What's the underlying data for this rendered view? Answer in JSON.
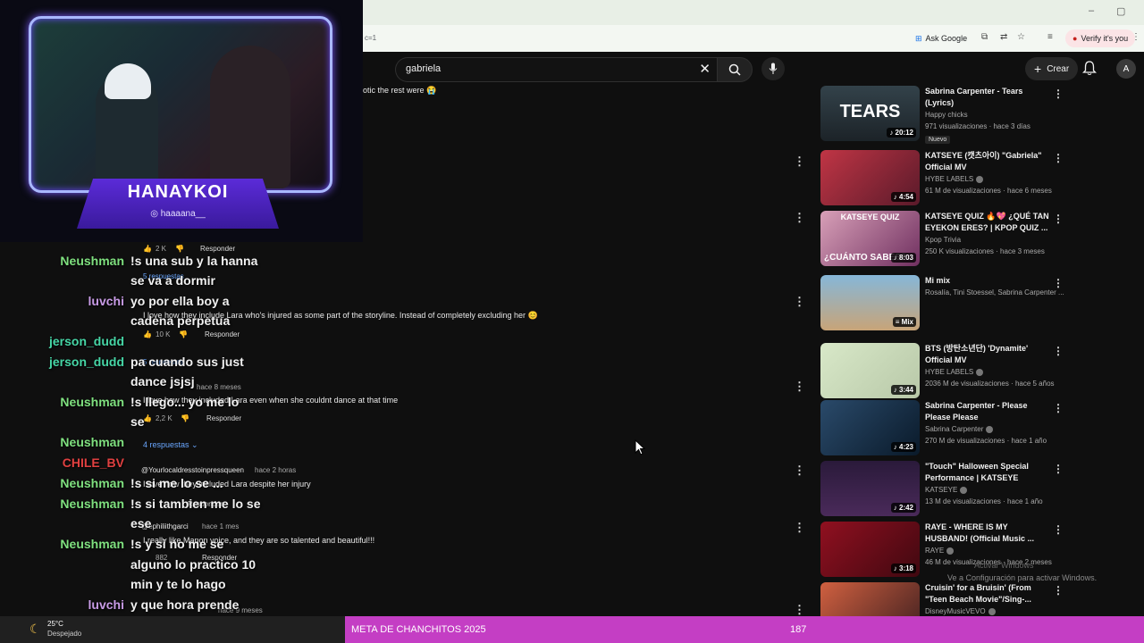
{
  "browser": {
    "url_fragment": "c=1",
    "ask_google_label": "Ask Google",
    "verify_label": "Verify it's you"
  },
  "youtube": {
    "search_value": "gabriela",
    "create_label": "Crear",
    "avatar_letter": "A"
  },
  "comments": {
    "frag_top": "otic the rest were 😭",
    "likes_1": "2 K",
    "reply_1": "Responder",
    "replies_toggle_1": "5 respuestas",
    "comment_2_text": "I love how they include Lara who's injured as some part of the storyline. Instead of completely excluding her 😊",
    "likes_2": "10 K",
    "reply_2": "Responder",
    "replies_toggle_2": "5 respuestas",
    "comment_3_time": "hace 8 meses",
    "comment_3_text": "I love how they included Lara even when she couldnt dance at that time",
    "likes_3": "2,2 K",
    "reply_3": "Responder",
    "replies_toggle_3": "4 respuestas",
    "comment_4_user": "@Yourlocaldresstoinpressqueen",
    "comment_4_time": "hace 2 horas",
    "comment_4_text": "I love how they included Lara despite her injury",
    "reply_4": "Responder",
    "comment_5_user": "@ephiliithgarci",
    "comment_5_time": "hace 1 mes",
    "comment_5_text": "I really like Manon voice, and they are so talented and beautiful!!!",
    "likes_5": "882",
    "reply_5": "Responder",
    "comment_6_time": "hace 9 meses"
  },
  "chat": [
    {
      "user": "Neushman",
      "color": "#7fe07f",
      "text": "!s una sub y la hanna"
    },
    {
      "user": "",
      "color": "",
      "text": "se va a dormir"
    },
    {
      "user": "luvchi",
      "color": "#c89be6",
      "text": "yo por ella boy a"
    },
    {
      "user": "",
      "color": "",
      "text": "cadena perpetua"
    },
    {
      "user": "jerson_dudd",
      "color": "#46d6a6",
      "text": ""
    },
    {
      "user": "jerson_dudd",
      "color": "#46d6a6",
      "text": "pa cuando sus just"
    },
    {
      "user": "",
      "color": "",
      "text": "dance jsjsj"
    },
    {
      "user": "Neushman",
      "color": "#7fe07f",
      "text": "!s llego... yo me lo"
    },
    {
      "user": "",
      "color": "",
      "text": "se"
    },
    {
      "user": "Neushman",
      "color": "#7fe07f",
      "text": ""
    },
    {
      "user": "CHILE_BV",
      "color": "#e04040",
      "text": ""
    },
    {
      "user": "Neushman",
      "color": "#7fe07f",
      "text": "!s si me lo se ..."
    },
    {
      "user": "Neushman",
      "color": "#7fe07f",
      "text": "!s si tambien me lo se"
    },
    {
      "user": "",
      "color": "",
      "text": "ese"
    },
    {
      "user": "Neushman",
      "color": "#7fe07f",
      "text": "!s y si no me se"
    },
    {
      "user": "",
      "color": "",
      "text": "alguno lo practico 10"
    },
    {
      "user": "",
      "color": "",
      "text": "min y te lo hago"
    },
    {
      "user": "luvchi",
      "color": "#c89be6",
      "text": "y que hora prende"
    },
    {
      "user": "",
      "color": "",
      "text": "guru guo"
    }
  ],
  "stream": {
    "streamer_name": "HANAYKOI",
    "instagram": "haaaana__",
    "goal_label": "META DE CHANCHITOS 2025",
    "goal_count": "187"
  },
  "recommendations": [
    {
      "title": "Sabrina Carpenter - Tears (Lyrics)",
      "channel": "Happy chicks",
      "meta": "971 visualizaciones · hace 3 días",
      "duration": "20:12",
      "badge": "Nuevo",
      "thumb_text": "TEARS",
      "verified": false
    },
    {
      "title": "KATSEYE (캣츠아이) \"Gabriela\" Official MV",
      "channel": "HYBE LABELS",
      "meta": "61 M de visualizaciones · hace 6 meses",
      "duration": "4:54",
      "verified": true
    },
    {
      "title": "KATSEYE QUIZ 🔥💖 ¿QUÉ TAN EYEKON ERES? | KPOP QUIZ ...",
      "channel": "Kpop Trivia",
      "meta": "250 K visualizaciones · hace 3 meses",
      "duration": "8:03",
      "thumb_text": "KATSEYE QUIZ",
      "thumb_text2": "¿CUÁNTO SABES?",
      "verified": false
    },
    {
      "title": "Mi mix",
      "channel": "Rosalía, Tini Stoessel, Sabrina Carpenter ...",
      "meta": "",
      "duration": "Mix",
      "verified": false
    },
    {
      "title": "BTS (방탄소년단) 'Dynamite' Official MV",
      "channel": "HYBE LABELS",
      "meta": "2036 M de visualizaciones · hace 5 años",
      "duration": "3:44",
      "verified": true
    },
    {
      "title": "Sabrina Carpenter - Please Please Please",
      "channel": "Sabrina Carpenter",
      "meta": "270 M de visualizaciones · hace 1 año",
      "duration": "4:23",
      "verified": true
    },
    {
      "title": "\"Touch\" Halloween Special Performance | KATSEYE",
      "channel": "KATSEYE",
      "meta": "13 M de visualizaciones · hace 1 año",
      "duration": "2:42",
      "verified": true
    },
    {
      "title": "RAYE - WHERE IS MY HUSBAND! (Official Music ...",
      "channel": "RAYE",
      "meta": "46 M de visualizaciones · hace 2 meses",
      "duration": "3:18",
      "verified": true
    },
    {
      "title": "Cruisin' for a Bruisin' (From \"Teen Beach Movie\"/Sing-...",
      "channel": "DisneyMusicVEVO",
      "meta": "",
      "duration": "",
      "verified": true
    }
  ],
  "windows": {
    "activate_title": "Activar Windows",
    "activate_text": "Ve a Configuración para activar Windows."
  },
  "taskbar": {
    "temperature": "25°C",
    "weather": "Despejado"
  }
}
